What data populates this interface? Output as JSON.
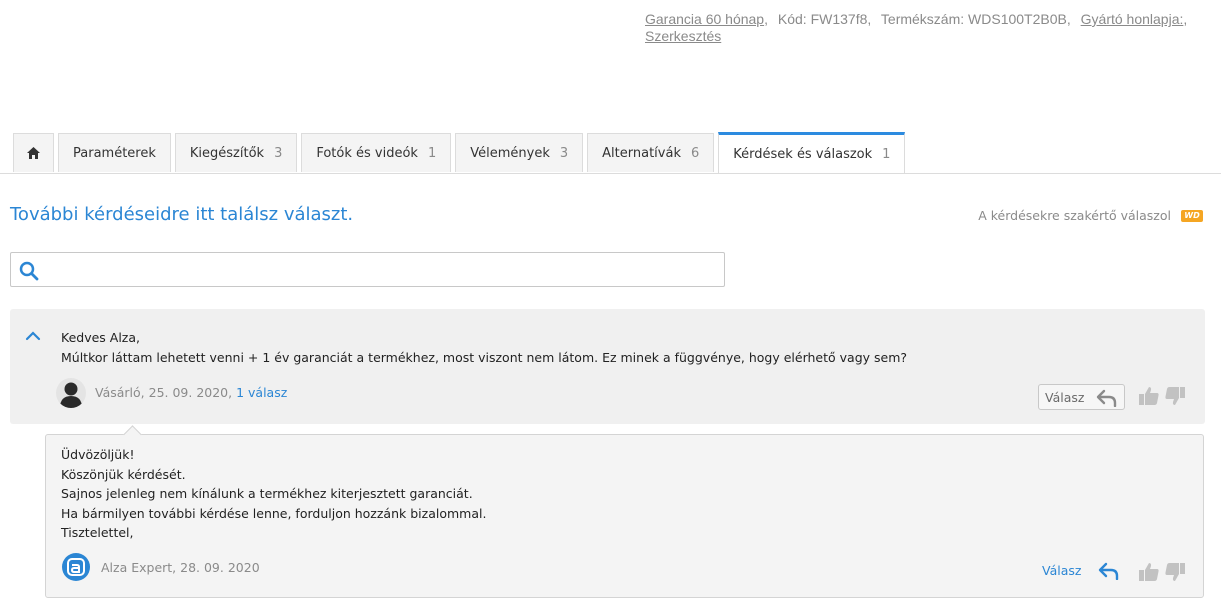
{
  "product_info": {
    "warranty": "Garancia 60 hónap",
    "code": "Kód: FW137f8",
    "part_number": "Termékszám: WDS100T2B0B",
    "manufacturer_link": "Gyártó honlapja:",
    "edit_link": "Szerkesztés"
  },
  "tabs": [
    {
      "label": "Paraméterek",
      "count": ""
    },
    {
      "label": "Kiegészítők",
      "count": "3"
    },
    {
      "label": "Fotók és videók",
      "count": "1"
    },
    {
      "label": "Vélemények",
      "count": "3"
    },
    {
      "label": "Alternatívák",
      "count": "6"
    },
    {
      "label": "Kérdések és válaszok",
      "count": "1"
    }
  ],
  "qa": {
    "heading": "További kérdéseidre itt találsz választ.",
    "expert_note": "A kérdésekre szakértő válaszol",
    "brand_logo_text": "WD",
    "search_placeholder": ""
  },
  "question": {
    "lines": [
      "Kedves Alza,",
      "Múltkor láttam lehetett venni + 1 év garanciát a termékhez, most viszont nem látom. Ez minek a függvénye, hogy elérhető vagy sem?"
    ],
    "author_date": "Vásárló, 25. 09. 2020,",
    "answers_link": "1 válasz",
    "reply_label": "Válasz"
  },
  "answer": {
    "lines": [
      "Üdvözöljük!",
      "Köszönjük kérdését.",
      "Sajnos jelenleg nem kínálunk a termékhez kiterjesztett garanciát.",
      "Ha bármilyen további kérdése lenne, forduljon hozzánk bizalommal.",
      "Tisztelettel,"
    ],
    "author_date": "Alza Expert, 28. 09. 2020",
    "reply_label": "Válasz"
  },
  "colors": {
    "accent": "#2b86d4",
    "tab_active_border": "#2c8be0",
    "wd_logo": "#f5a623",
    "muted_text": "#8a8a8a"
  }
}
